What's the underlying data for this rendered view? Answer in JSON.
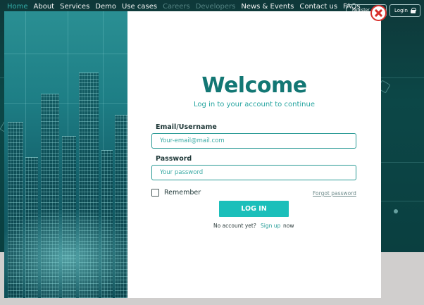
{
  "nav": {
    "links": [
      "Home",
      "About",
      "Services",
      "Demo",
      "Use cases",
      "Careers",
      "Developers",
      "News & Events",
      "Contact us",
      "FAQs"
    ],
    "register_label": "Register",
    "login_label": "Login"
  },
  "modal": {
    "title": "Welcome",
    "subtitle": "Log in to your account to continue",
    "email_label": "Email/Username",
    "email_placeholder": "Your-email@mail.com",
    "password_label": "Password",
    "password_placeholder": "Your password",
    "remember_label": "Remember",
    "forgot_label": "Forgot password",
    "submit_label": "LOG IN",
    "signup_prefix": "No account yet?",
    "signup_link": "Sign up",
    "signup_suffix": "now"
  },
  "colors": {
    "accent": "#1bbfba",
    "title": "#137774",
    "close": "#d8302c"
  }
}
